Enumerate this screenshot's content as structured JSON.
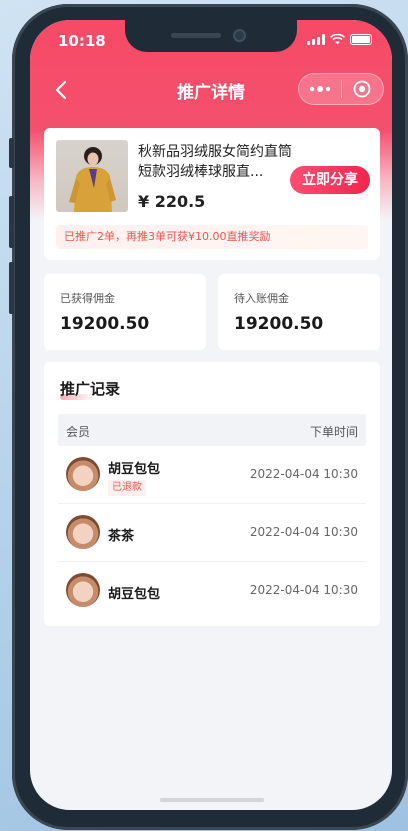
{
  "status_bar": {
    "time": "10:18"
  },
  "nav": {
    "title": "推广详情"
  },
  "product": {
    "title": "秋新品羽绒服女简约直筒短款羽绒棒球服直...",
    "price": "¥ 220.5",
    "share_label": "立即分享",
    "promo_tip": "已推广2单，再推3单可获¥10.00直推奖励"
  },
  "stats": [
    {
      "label": "已获得佣金",
      "value": "19200.50"
    },
    {
      "label": "待入账佣金",
      "value": "19200.50"
    }
  ],
  "records": {
    "title": "推广记录",
    "header": {
      "member": "会员",
      "order_time": "下单时间"
    },
    "rows": [
      {
        "name": "胡豆包包",
        "tag": "已退款",
        "time": "2022-04-04 10:30"
      },
      {
        "name": "茶茶",
        "tag": "",
        "time": "2022-04-04 10:30"
      },
      {
        "name": "胡豆包包",
        "tag": "",
        "time": "2022-04-04 10:30"
      }
    ]
  },
  "colors": {
    "accent": "#f74a66",
    "share_button": "#f0274f",
    "refund_tag": "#f0564e"
  }
}
